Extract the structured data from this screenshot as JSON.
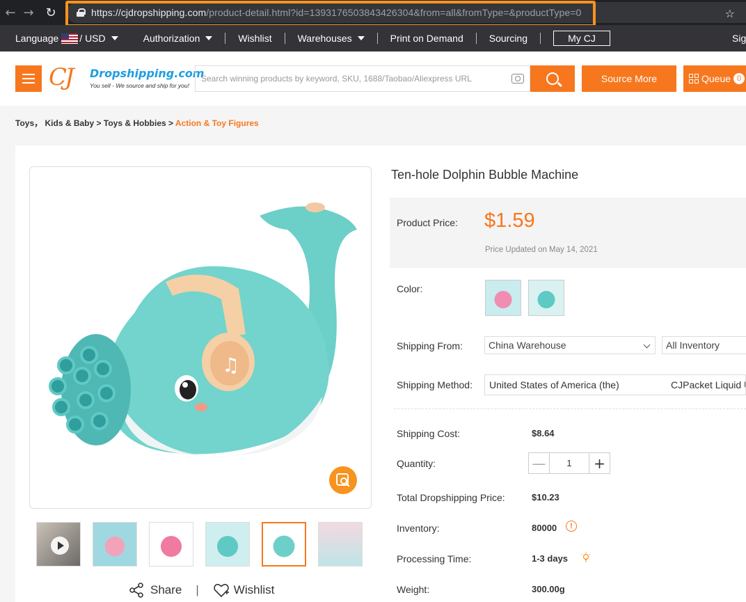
{
  "browser": {
    "url_domain": "https://cjdropshipping.com",
    "url_path": "/product-detail.html?id=1393176503843426304&from=all&fromType=&productType=0",
    "back_icon": "arrow-left-icon",
    "forward_icon": "arrow-right-icon",
    "refresh_icon": "refresh-icon",
    "star_icon": "star-icon",
    "highlight_color": "#f7931e"
  },
  "topnav": {
    "language_label": "Language",
    "currency": "/ USD",
    "authorization": "Authorization",
    "wishlist": "Wishlist",
    "warehouses": "Warehouses",
    "print_on_demand": "Print on Demand",
    "sourcing": "Sourcing",
    "my_cj": "My CJ",
    "sign_in": "Sign"
  },
  "header": {
    "logo_mark": "CJ",
    "logo_name": "Dropshipping.com",
    "logo_tagline": "You sell - We source and ship for you!",
    "search_placeholder": "Search winning products by keyword, SKU, 1688/Taobao/Aliexpress URL",
    "source_more": "Source More",
    "queue_label": "Queue",
    "queue_count": "0",
    "accent_color": "#f7771e"
  },
  "breadcrumb": {
    "items": [
      "Toys",
      "Kids & Baby",
      "Toys & Hobbies",
      "Action & Toy Figures"
    ],
    "sep_comma": "，",
    "sep_arrow": ">"
  },
  "product": {
    "title": "Ten-hole Dolphin Bubble Machine",
    "price_label": "Product Price:",
    "price": "$1.59",
    "price_updated": "Price Updated on May 14, 2021",
    "color_label": "Color:",
    "shipping_from_label": "Shipping From:",
    "shipping_from_value": "China Warehouse",
    "inventory_filter": "All Inventory",
    "shipping_method_label": "Shipping Method:",
    "shipping_country": "United States of America (the)",
    "shipping_method": "CJPacket Liquid US",
    "shipping_cost_label": "Shipping Cost:",
    "shipping_cost": "$8.64",
    "quantity_label": "Quantity:",
    "quantity_minus": "—",
    "quantity": "1",
    "quantity_plus": "+",
    "total_label": "Total Dropshipping Price:",
    "total": "$10.23",
    "inventory_label": "Inventory:",
    "inventory": "80000",
    "inventory_info_icon": "!",
    "processing_label": "Processing Time:",
    "processing": "1-3 days",
    "weight_label": "Weight:",
    "weight": "300.00g"
  },
  "gallery": {
    "share": "Share",
    "divider": "|",
    "wishlist": "Wishlist",
    "thumb_count": 6,
    "active_thumb": 5
  }
}
